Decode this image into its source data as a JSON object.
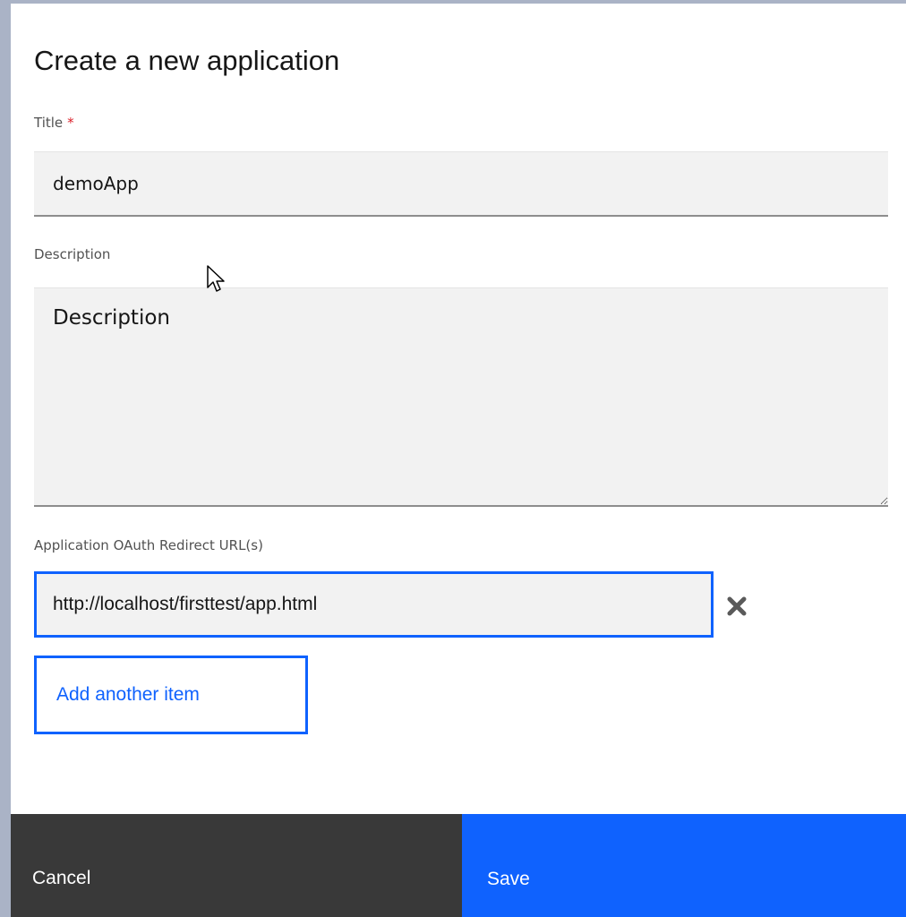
{
  "dialog": {
    "title": "Create a new application"
  },
  "form": {
    "title_field": {
      "label": "Title",
      "required_marker": "*",
      "value": "demoApp"
    },
    "description_field": {
      "label": "Description",
      "placeholder": "Description",
      "value": ""
    },
    "redirect_urls": {
      "label": "Application OAuth Redirect URL(s)",
      "items": [
        {
          "value": "http://localhost/firsttest/app.html",
          "remove_icon": "close-icon"
        }
      ],
      "add_label": "Add another item"
    }
  },
  "footer": {
    "cancel_label": "Cancel",
    "save_label": "Save"
  },
  "colors": {
    "primary": "#0f62fe",
    "secondary_button": "#393939",
    "field_background": "#f2f2f2",
    "required": "#da1e28",
    "icon": "#5a5a5a"
  }
}
